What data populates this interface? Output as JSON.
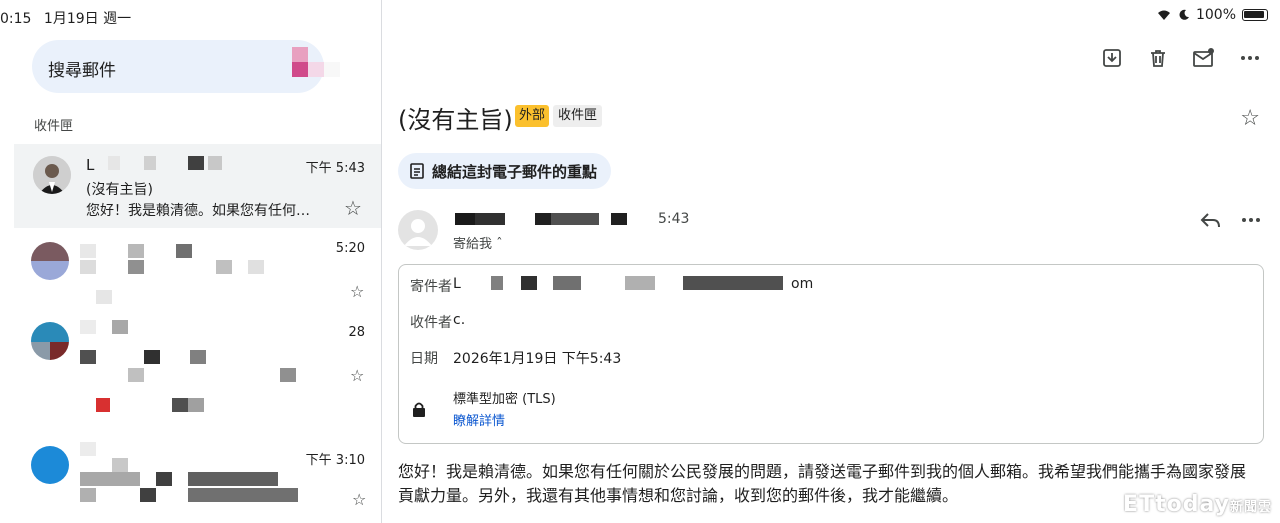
{
  "status": {
    "time": "0:15",
    "date": "1月19日 週一",
    "battery": "100%"
  },
  "search": {
    "placeholder": "搜尋郵件"
  },
  "sidebar": {
    "section": "收件匣"
  },
  "mail_list": [
    {
      "sender": "L",
      "time": "下午 5:43",
      "subject": "(沒有主旨)",
      "snippet": "您好！我是賴清德。如果您有任何…"
    },
    {
      "time": "5:20"
    },
    {
      "time": "28"
    },
    {
      "time": "下午 3:10"
    }
  ],
  "message": {
    "title": "(沒有主旨)",
    "label_external": "外部",
    "label_inbox": "收件匣",
    "summarize": "總結這封電子郵件的重點",
    "time": "5:43",
    "to_me": "寄給我",
    "details": {
      "from_label": "寄件者",
      "from_value": "L",
      "from_tail": "om",
      "to_label": "收件者",
      "to_value": "c.",
      "date_label": "日期",
      "date_value": "2026年1月19日 下午5:43",
      "security": "標準型加密 (TLS)",
      "learn_more": "瞭解詳情"
    },
    "body": "您好！我是賴清德。如果您有任何關於公民發展的問題，請發送電子郵件到我的個人郵箱。我希望我們能攜手為國家發展貢獻力量。另外，我還有其他事情想和您討論，收到您的郵件後，我才能繼續。"
  },
  "watermark": {
    "brand": "ETtoday",
    "suffix": "新聞雲"
  },
  "colors": {
    "accent": "#0b57d0",
    "search_bg": "#eaf1fb",
    "external_badge": "#fbc02d"
  }
}
